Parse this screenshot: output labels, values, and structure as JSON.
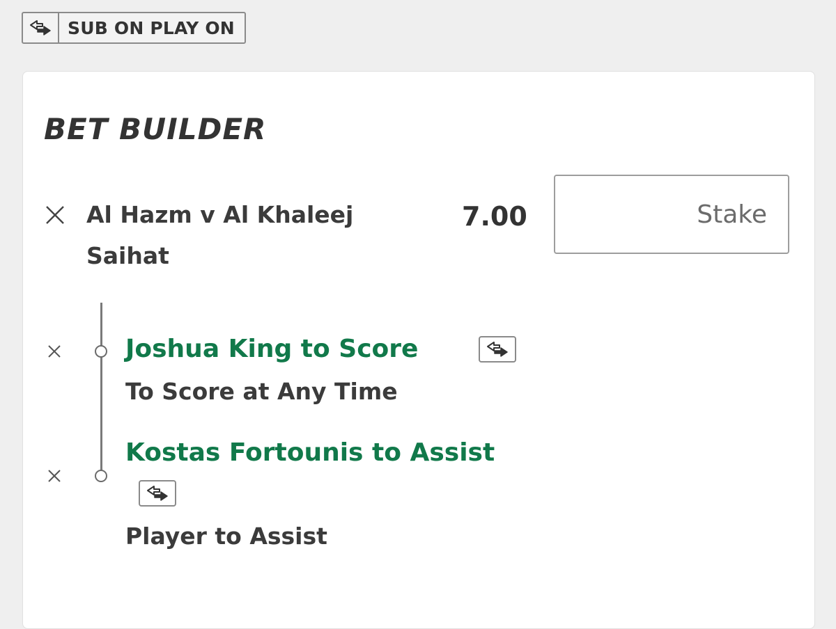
{
  "header": {
    "badge_label": "SUB ON PLAY ON",
    "badge_icon": "swap-icon"
  },
  "bet_builder": {
    "title": "BET BUILDER",
    "match": "Al Hazm v Al Khaleej",
    "selection": "Saihat",
    "odds": "7.00",
    "stake_placeholder": "Stake",
    "legs": [
      {
        "title": "Joshua King to Score",
        "market": "To Score at Any Time",
        "icon": "swap-icon"
      },
      {
        "title": "Kostas Fortounis to Assist",
        "market": "Player to Assist",
        "icon": "swap-icon"
      }
    ]
  },
  "colors": {
    "background": "#efefef",
    "card": "#ffffff",
    "accent_green": "#11794a",
    "text_dark": "#3b3b3b"
  }
}
